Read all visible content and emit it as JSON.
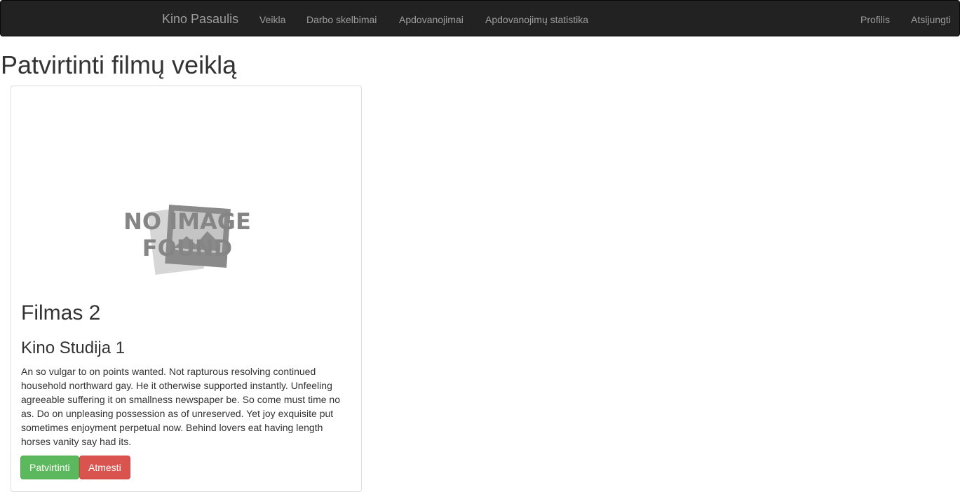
{
  "navbar": {
    "brand": "Kino Pasaulis",
    "items": [
      {
        "label": "Veikla"
      },
      {
        "label": "Darbo skelbimai"
      },
      {
        "label": "Apdovanojimai"
      },
      {
        "label": "Apdovanojimų statistika"
      }
    ],
    "right_items": [
      {
        "label": "Profilis"
      },
      {
        "label": "Atsijungti"
      }
    ]
  },
  "page": {
    "title": "Patvirtinti filmų veiklą"
  },
  "card": {
    "image": {
      "icon": "image-placeholder-icon",
      "line1": "NO IMAGE",
      "line2": "FOUND"
    },
    "film_title": "Filmas 2",
    "studio": "Kino Studija 1",
    "description": "An so vulgar to on points wanted. Not rapturous resolving continued household northward gay. He it otherwise supported instantly. Unfeeling agreeable suffering it on smallness newspaper be. So come must time no as. Do on unpleasing possession as of unreserved. Yet joy exquisite put sometimes enjoyment perpetual now. Behind lovers eat having length horses vanity say had its.",
    "approve_label": "Patvirtinti",
    "reject_label": "Atmesti"
  },
  "colors": {
    "navbar_bg": "#222222",
    "nav_text": "#9d9d9d",
    "success": "#5cb85c",
    "danger": "#d9534f"
  }
}
